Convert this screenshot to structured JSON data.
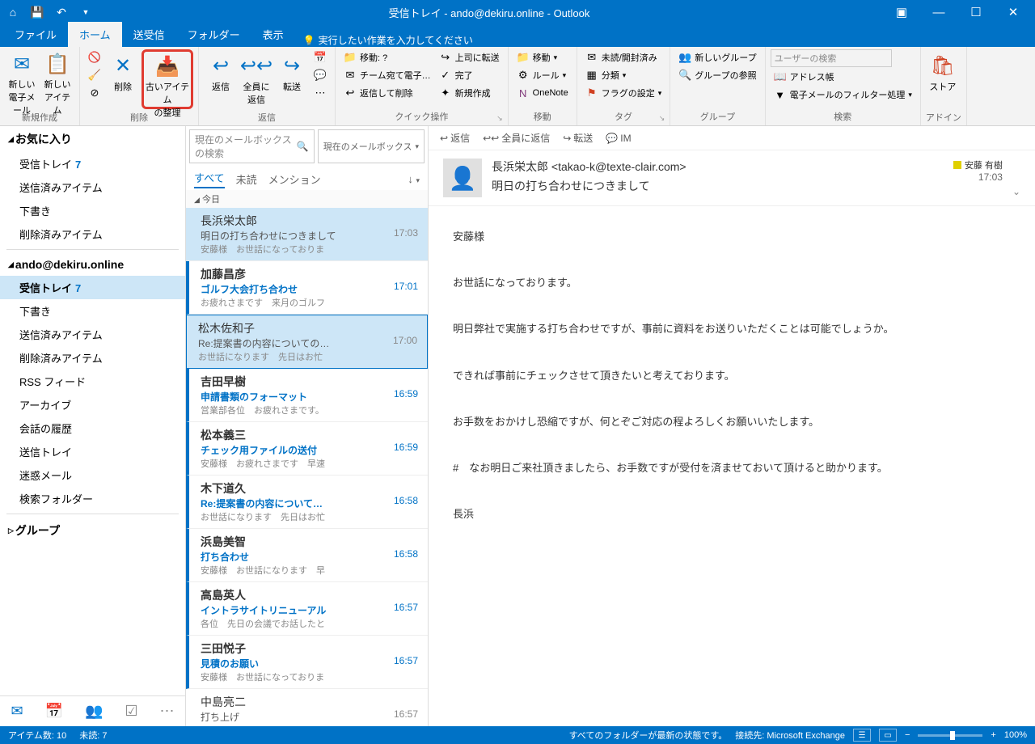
{
  "titlebar": {
    "title": "受信トレイ - ando@dekiru.online - Outlook"
  },
  "tabs": {
    "file": "ファイル",
    "home": "ホーム",
    "sendrecv": "送受信",
    "folder": "フォルダー",
    "view": "表示",
    "tellme": "実行したい作業を入力してください"
  },
  "ribbon": {
    "new_group": "新規作成",
    "new_mail": "新しい\n電子メール",
    "new_items": "新しい\nアイテム",
    "delete_group": "削除",
    "delete": "削除",
    "archive": "古いアイテム\nの整理",
    "reply_group": "返信",
    "reply": "返信",
    "reply_all": "全員に\n返信",
    "forward": "転送",
    "quick_group": "クイック操作",
    "move_to": "移動: ?",
    "team_mail": "チーム宛て電子…",
    "reply_delete": "返信して削除",
    "to_boss": "上司に転送",
    "done": "完了",
    "create_new": "新規作成",
    "move_group": "移動",
    "move": "移動",
    "rules": "ルール",
    "onenote": "OneNote",
    "tag_group": "タグ",
    "unread": "未読/開封済み",
    "category": "分類",
    "flag": "フラグの設定",
    "groups_group": "グループ",
    "new_group_btn": "新しいグループ",
    "browse_groups": "グループの参照",
    "search_group": "検索",
    "search_placeholder": "ユーザーの検索",
    "address_book": "アドレス帳",
    "filter": "電子メールのフィルター処理",
    "addin_group": "アドイン",
    "store": "ストア"
  },
  "nav": {
    "favorites": "お気に入り",
    "fav_items": [
      {
        "label": "受信トレイ",
        "count": "7"
      },
      {
        "label": "送信済みアイテム"
      },
      {
        "label": "下書き"
      },
      {
        "label": "削除済みアイテム"
      }
    ],
    "account": "ando@dekiru.online",
    "acct_items": [
      {
        "label": "受信トレイ",
        "count": "7",
        "selected": true
      },
      {
        "label": "下書き"
      },
      {
        "label": "送信済みアイテム"
      },
      {
        "label": "削除済みアイテム"
      },
      {
        "label": "RSS フィード"
      },
      {
        "label": "アーカイブ"
      },
      {
        "label": "会話の履歴"
      },
      {
        "label": "送信トレイ"
      },
      {
        "label": "迷惑メール"
      },
      {
        "label": "検索フォルダー"
      }
    ],
    "groups": "グループ"
  },
  "list": {
    "search_placeholder": "現在のメールボックス の検索",
    "scope": "現在のメールボックス",
    "filter_all": "すべて",
    "filter_unread": "未読",
    "filter_mention": "メンション",
    "group_today": "今日",
    "messages": [
      {
        "sender": "長浜栄太郎",
        "subject": "明日の打ち合わせにつきまして",
        "preview": "安藤様　お世話になっておりま",
        "time": "17:03",
        "selected": true
      },
      {
        "sender": "加藤昌彦",
        "subject": "ゴルフ大会打ち合わせ",
        "preview": "お疲れさまです　来月のゴルフ",
        "time": "17:01",
        "unread": true
      },
      {
        "sender": "松木佐和子",
        "subject": "Re:提案書の内容についての…",
        "preview": "お世話になります　先日はお忙",
        "time": "17:00",
        "focused": true
      },
      {
        "sender": "吉田早樹",
        "subject": "申請書類のフォーマット",
        "preview": "営業部各位　お疲れさまです。",
        "time": "16:59",
        "unread": true
      },
      {
        "sender": "松本義三",
        "subject": "チェック用ファイルの送付",
        "preview": "安藤様　お疲れさまです　早速",
        "time": "16:59",
        "unread": true
      },
      {
        "sender": "木下道久",
        "subject": "Re:提案書の内容について…",
        "preview": "お世話になります　先日はお忙",
        "time": "16:58",
        "unread": true
      },
      {
        "sender": "浜島美智",
        "subject": "打ち合わせ",
        "preview": "安藤様　お世話になります　早",
        "time": "16:58",
        "unread": true
      },
      {
        "sender": "高島英人",
        "subject": "イントラサイトリニューアル",
        "preview": "各位　先日の会議でお話したと",
        "time": "16:57",
        "unread": true
      },
      {
        "sender": "三田悦子",
        "subject": "見積のお願い",
        "preview": "安藤様　お世話になっておりま",
        "time": "16:57",
        "unread": true
      },
      {
        "sender": "中島亮二",
        "subject": "打ち上げ",
        "preview": "",
        "time": "16:57"
      }
    ]
  },
  "reading": {
    "actions": {
      "reply": "返信",
      "reply_all": "全員に返信",
      "forward": "転送",
      "im": "IM"
    },
    "from": "長浜栄太郎 <takao-k@texte-clair.com>",
    "subject": "明日の打ち合わせにつきまして",
    "time": "17:03",
    "category": "安藤 有樹",
    "body": "安藤様\n\nお世話になっております。\n\n明日弊社で実施する打ち合わせですが、事前に資料をお送りいただくことは可能でしょうか。\n\nできれば事前にチェックさせて頂きたいと考えております。\n\nお手数をおかけし恐縮ですが、何とぞご対応の程よろしくお願いいたします。\n\n#　なお明日ご来社頂きましたら、お手数ですが受付を済ませておいて頂けると助かります。\n\n長浜"
  },
  "status": {
    "items": "アイテム数: 10",
    "unread": "未読: 7",
    "folders": "すべてのフォルダーが最新の状態です。",
    "connection": "接続先: Microsoft Exchange",
    "zoom": "100%"
  }
}
